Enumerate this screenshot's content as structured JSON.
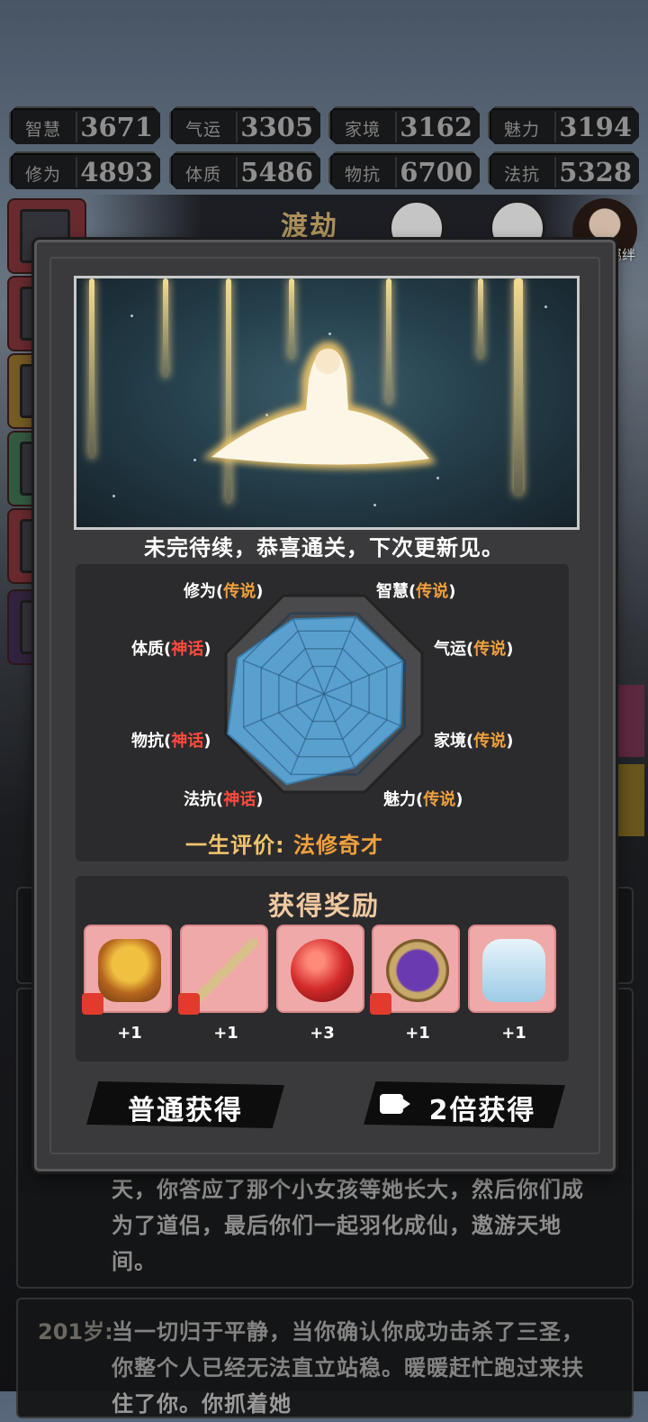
{
  "stats": [
    {
      "label": "智慧",
      "value": "3671"
    },
    {
      "label": "气运",
      "value": "3305"
    },
    {
      "label": "家境",
      "value": "3162"
    },
    {
      "label": "魅力",
      "value": "3194"
    },
    {
      "label": "修为",
      "value": "4893"
    },
    {
      "label": "体质",
      "value": "5486"
    },
    {
      "label": "物抗",
      "value": "6700"
    },
    {
      "label": "法抗",
      "value": "5328"
    }
  ],
  "header": {
    "title": "渡劫",
    "companion_label": "羁绊"
  },
  "modal": {
    "caption": "未完待续，恭喜通关，下次更新见。",
    "radar": {
      "axes": [
        {
          "name": "智慧",
          "grade": "传说"
        },
        {
          "name": "气运",
          "grade": "传说"
        },
        {
          "name": "家境",
          "grade": "传说"
        },
        {
          "name": "魅力",
          "grade": "传说"
        },
        {
          "name": "法抗",
          "grade": "神话"
        },
        {
          "name": "物抗",
          "grade": "神话"
        },
        {
          "name": "体质",
          "grade": "神话"
        },
        {
          "name": "修为",
          "grade": "传说"
        }
      ],
      "values": [
        0.78,
        0.8,
        0.78,
        0.75,
        0.92,
        0.98,
        0.88,
        0.76
      ],
      "fill_color": "#5aa0cf"
    },
    "evaluation": {
      "label": "一生评价:",
      "value": "法修奇才"
    },
    "rewards_title": "获得奖励",
    "rewards": [
      {
        "item": "incense-burner-icon",
        "count": "+1",
        "fragment": true
      },
      {
        "item": "sword-icon",
        "count": "+1",
        "fragment": true
      },
      {
        "item": "red-orb-icon",
        "count": "+3",
        "fragment": false
      },
      {
        "item": "mirror-icon",
        "count": "+1",
        "fragment": true
      },
      {
        "item": "robe-icon",
        "count": "+1",
        "fragment": false
      }
    ],
    "buttons": {
      "normal": "普通获得",
      "double": "2倍获得"
    }
  },
  "log": {
    "entry1": "天，你答应了那个小女孩等她长大，然后你们成为了道侣，最后你们一起羽化成仙，遨游天地间。",
    "entry2_age": "201岁:",
    "entry2": "当一切归于平静，当你确认你成功击杀了三圣，你整个人已经无法直立站稳。暖暖赶忙跑过来扶住了你。你抓着她"
  }
}
